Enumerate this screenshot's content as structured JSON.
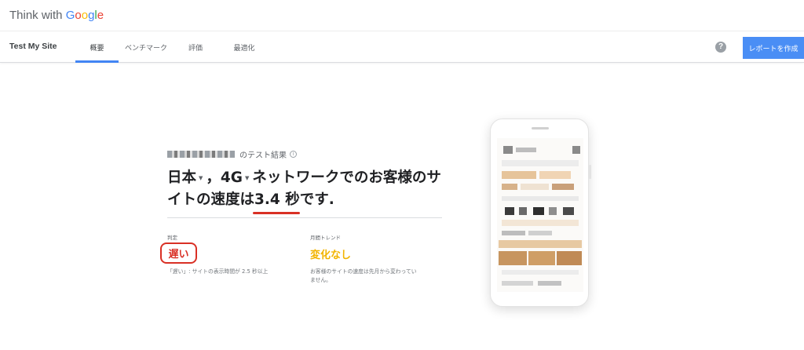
{
  "brand": {
    "think_with": "Think with ",
    "google_letters": [
      "G",
      "o",
      "o",
      "g",
      "l",
      "e"
    ]
  },
  "nav": {
    "title": "Test My Site",
    "tabs": [
      {
        "label": "概要",
        "active": true
      },
      {
        "label": "ベンチマーク",
        "active": false
      },
      {
        "label": "評価",
        "active": false
      },
      {
        "label": "最適化",
        "active": false
      }
    ],
    "help_symbol": "?",
    "report_button": "レポートを作成"
  },
  "result": {
    "subtitle_suffix": "のテスト結果",
    "info_symbol": "i",
    "headline": {
      "country": "日本",
      "comma": "，",
      "network": "4G",
      "part1": "ネットワークでのお客様のサイトの速度は",
      "speed": "3.4 秒",
      "part2": "です."
    },
    "verdict_label": "判定",
    "verdict_value": "遅い",
    "verdict_note": "「遅い」: サイトの表示時間が 2.5 秒以上",
    "trend_label": "月間トレンド",
    "trend_value": "変化なし",
    "trend_note_line1": "お客様のサイトの速度は先月から変わってい",
    "trend_note_line2": "ません。"
  },
  "colors": {
    "accent_blue": "#4285F4",
    "button_blue": "#4a8ef5",
    "slow_red": "#d93025",
    "trend_yellow": "#f2b400",
    "google_blue": "#4285F4",
    "google_red": "#EA4335",
    "google_yellow": "#FBBC05",
    "google_green": "#34A853"
  },
  "icons": {
    "help": "help-circle-icon",
    "info": "info-circle-icon",
    "dropdown": "caret-down-icon"
  }
}
